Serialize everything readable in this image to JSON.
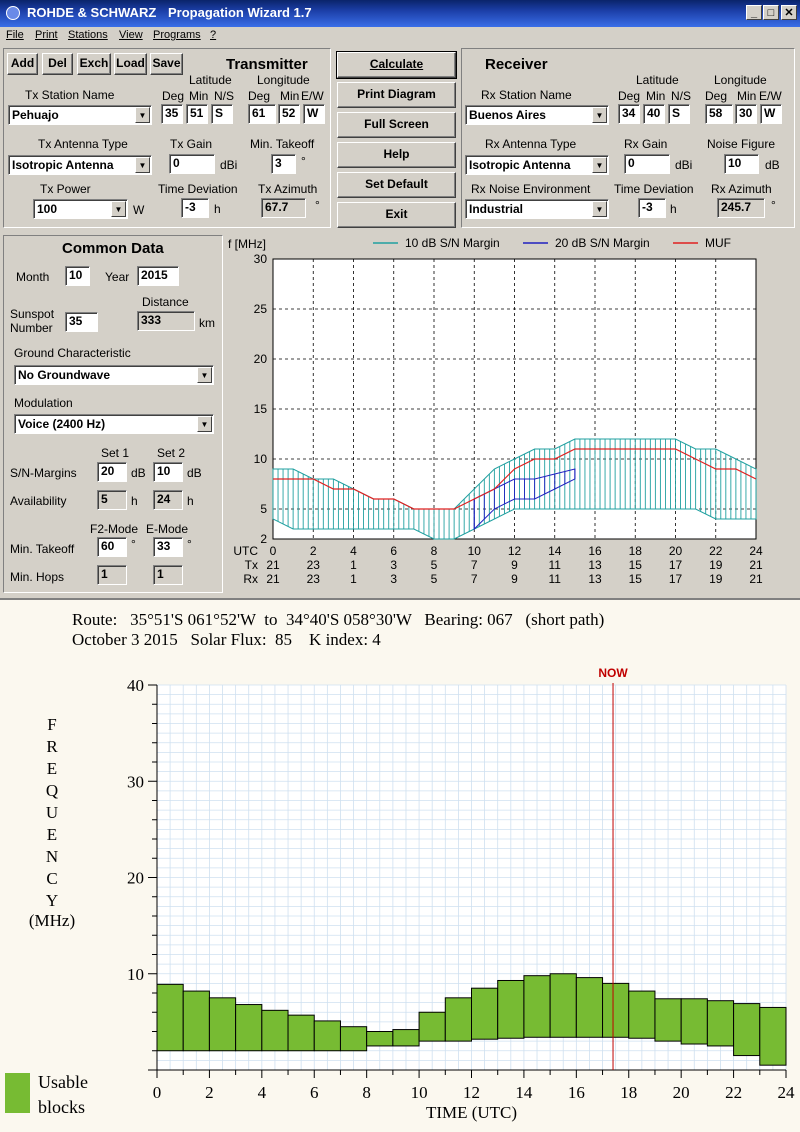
{
  "window": {
    "brand": "ROHDE & SCHWARZ",
    "title": "Propagation Wizard  1.7"
  },
  "menu": [
    "File",
    "Print",
    "Stations",
    "View",
    "Programs",
    "?"
  ],
  "toolbar": [
    "Add",
    "Del",
    "Exch",
    "Load",
    "Save"
  ],
  "transmitter": {
    "heading": "Transmitter",
    "station_label": "Tx Station Name",
    "station": "Pehuajo",
    "lat_label": "Latitude",
    "lon_label": "Longitude",
    "lat_sub": [
      "Deg",
      "Min",
      "N/S"
    ],
    "lon_sub": [
      "Deg",
      "Min",
      "E/W"
    ],
    "lat": [
      "35",
      "51",
      "S"
    ],
    "lon": [
      "61",
      "52",
      "W"
    ],
    "antenna_label": "Tx Antenna Type",
    "antenna": "Isotropic Antenna",
    "gain_label": "Tx Gain",
    "gain": "0",
    "gain_unit": "dBi",
    "takeoff_label": "Min. Takeoff",
    "takeoff": "3",
    "deg_sym": "°",
    "power_label": "Tx Power",
    "power": "100",
    "power_unit": "W",
    "timedev_label": "Time Deviation",
    "timedev": "-3",
    "timedev_unit": "h",
    "azimuth_label": "Tx Azimuth",
    "azimuth": "67.7"
  },
  "center_buttons": [
    "Calculate",
    "Print Diagram",
    "Full Screen",
    "Help",
    "Set Default",
    "Exit"
  ],
  "receiver": {
    "heading": "Receiver",
    "station_label": "Rx Station Name",
    "station": "Buenos Aires",
    "lat_label": "Latitude",
    "lon_label": "Longitude",
    "lat_sub": [
      "Deg",
      "Min",
      "N/S"
    ],
    "lon_sub": [
      "Deg",
      "Min",
      "E/W"
    ],
    "lat": [
      "34",
      "40",
      "S"
    ],
    "lon": [
      "58",
      "30",
      "W"
    ],
    "antenna_label": "Rx Antenna Type",
    "antenna": "Isotropic Antenna",
    "gain_label": "Rx Gain",
    "gain": "0",
    "gain_unit": "dBi",
    "noise_fig_label": "Noise Figure",
    "noise_fig": "10",
    "noise_fig_unit": "dB",
    "env_label": "Rx Noise Environment",
    "env": "Industrial",
    "timedev_label": "Time Deviation",
    "timedev": "-3",
    "timedev_unit": "h",
    "azimuth_label": "Rx Azimuth",
    "azimuth": "245.7",
    "deg_sym": "°"
  },
  "common": {
    "heading": "Common Data",
    "month_label": "Month",
    "month": "10",
    "year_label": "Year",
    "year": "2015",
    "sunspot_label1": "Sunspot",
    "sunspot_label2": "Number",
    "sunspot": "35",
    "distance_label": "Distance",
    "distance": "333",
    "distance_unit": "km",
    "ground_label": "Ground Characteristic",
    "ground": "No Groundwave",
    "mod_label": "Modulation",
    "mod": "Voice   (2400 Hz)",
    "set1": "Set 1",
    "set2": "Set 2",
    "snm_label": "S/N-Margins",
    "snm1": "20",
    "snm2": "10",
    "snm_unit": "dB",
    "avail_label": "Availability",
    "avail1": "5",
    "avail2": "24",
    "avail_unit": "h",
    "f2": "F2-Mode",
    "emode": "E-Mode",
    "takeoff_label": "Min. Takeoff",
    "takeoff1": "60",
    "takeoff2": "33",
    "deg_sym": "°",
    "hops_label": "Min. Hops",
    "hops1": "1",
    "hops2": "1"
  },
  "chart_data": [
    {
      "type": "line",
      "ylabel": "f [MHz]",
      "ylim": [
        2,
        30
      ],
      "yticks": [
        2,
        5,
        10,
        15,
        20,
        25,
        30
      ],
      "xlim": [
        0,
        24
      ],
      "row_labels": [
        "UTC",
        "Tx",
        "Rx"
      ],
      "utc": [
        "0",
        "2",
        "4",
        "6",
        "8",
        "10",
        "12",
        "14",
        "16",
        "18",
        "20",
        "22",
        "24"
      ],
      "tx": [
        "21",
        "23",
        "1",
        "3",
        "5",
        "7",
        "9",
        "11",
        "13",
        "15",
        "17",
        "19",
        "21"
      ],
      "rx": [
        "21",
        "23",
        "1",
        "3",
        "5",
        "7",
        "9",
        "11",
        "13",
        "15",
        "17",
        "19",
        "21"
      ],
      "grid": true,
      "legend_position": "top",
      "series": [
        {
          "name": "10 dB S/N Margin",
          "color": "#20a0a0",
          "kind": "band",
          "x": [
            0,
            1,
            2,
            3,
            4,
            5,
            6,
            7,
            8,
            9,
            10,
            11,
            12,
            13,
            14,
            15,
            16,
            17,
            18,
            19,
            20,
            21,
            22,
            23,
            24
          ],
          "upper": [
            9,
            9,
            8,
            8,
            7,
            6,
            6,
            5,
            5,
            5,
            7,
            9,
            10,
            11,
            11,
            12,
            12,
            12,
            12,
            12,
            12,
            11,
            11,
            10,
            9
          ],
          "lower": [
            4,
            3,
            3,
            3,
            3,
            3,
            3,
            3,
            2,
            2,
            3,
            4,
            5,
            5,
            5,
            5,
            5,
            5,
            5,
            5,
            5,
            5,
            4,
            4,
            4
          ]
        },
        {
          "name": "20 dB S/N Margin",
          "color": "#2020c0",
          "kind": "band",
          "x": [
            10,
            11,
            12,
            13,
            14,
            15
          ],
          "upper": [
            6,
            7,
            8,
            8,
            8.5,
            9
          ],
          "lower": [
            3,
            5,
            6,
            6,
            7,
            8
          ]
        },
        {
          "name": "MUF",
          "color": "#e02020",
          "kind": "line",
          "x": [
            0,
            1,
            2,
            3,
            4,
            5,
            6,
            7,
            8,
            9,
            10,
            11,
            12,
            13,
            14,
            15,
            16,
            17,
            18,
            19,
            20,
            21,
            22,
            23,
            24
          ],
          "y": [
            8,
            8,
            8,
            7,
            7,
            6,
            6,
            5,
            5,
            5,
            6,
            7,
            9,
            10,
            10,
            11,
            11,
            11,
            11,
            11,
            11,
            10,
            9,
            9,
            8
          ]
        }
      ]
    },
    {
      "type": "bar",
      "route": "Route:   35°51'S 061°52'W  to  34°40'S 058°30'W   Bearing: 067   (short path)",
      "date_line": "October 3 2015   Solar Flux:  85    K index: 4",
      "now_label": "NOW",
      "now_utc": 17.4,
      "ylabel_letters": [
        "F",
        "R",
        "E",
        "Q",
        "U",
        "E",
        "N",
        "C",
        "Y"
      ],
      "ylabel_unit": "(MHz)",
      "xlabel": "TIME (UTC)",
      "ylim": [
        0,
        40
      ],
      "yticks": [
        10,
        20,
        30,
        40
      ],
      "xlim": [
        0,
        24
      ],
      "xticks": [
        0,
        2,
        4,
        6,
        8,
        10,
        12,
        14,
        16,
        18,
        20,
        22,
        24
      ],
      "legend": "Usable blocks",
      "legend_lines": [
        "Usable",
        "blocks"
      ],
      "color": "#77bb33",
      "blocks": [
        {
          "h": 0,
          "low": 2,
          "high": 8.9
        },
        {
          "h": 1,
          "low": 2,
          "high": 8.2
        },
        {
          "h": 2,
          "low": 2,
          "high": 7.5
        },
        {
          "h": 3,
          "low": 2,
          "high": 6.8
        },
        {
          "h": 4,
          "low": 2,
          "high": 6.2
        },
        {
          "h": 5,
          "low": 2,
          "high": 5.7
        },
        {
          "h": 6,
          "low": 2,
          "high": 5.1
        },
        {
          "h": 7,
          "low": 2,
          "high": 4.5
        },
        {
          "h": 8,
          "low": 2.5,
          "high": 4.0
        },
        {
          "h": 9,
          "low": 2.5,
          "high": 4.2
        },
        {
          "h": 10,
          "low": 3.0,
          "high": 6.0
        },
        {
          "h": 11,
          "low": 3.0,
          "high": 7.5
        },
        {
          "h": 12,
          "low": 3.2,
          "high": 8.5
        },
        {
          "h": 13,
          "low": 3.3,
          "high": 9.3
        },
        {
          "h": 14,
          "low": 3.4,
          "high": 9.8
        },
        {
          "h": 15,
          "low": 3.4,
          "high": 10.0
        },
        {
          "h": 16,
          "low": 3.4,
          "high": 9.6
        },
        {
          "h": 17,
          "low": 3.4,
          "high": 9.0
        },
        {
          "h": 18,
          "low": 3.3,
          "high": 8.2
        },
        {
          "h": 19,
          "low": 3.0,
          "high": 7.4
        },
        {
          "h": 20,
          "low": 2.7,
          "high": 7.4
        },
        {
          "h": 21,
          "low": 2.5,
          "high": 7.2
        },
        {
          "h": 22,
          "low": 1.5,
          "high": 6.9
        },
        {
          "h": 23,
          "low": 0.5,
          "high": 6.5
        }
      ]
    }
  ]
}
